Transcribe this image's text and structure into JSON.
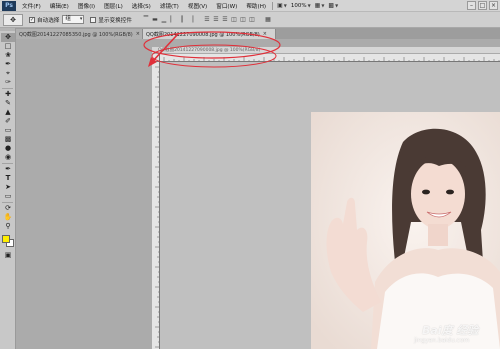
{
  "app": {
    "logo": "Ps"
  },
  "menubar": {
    "items": [
      "文件(F)",
      "编辑(E)",
      "图像(I)",
      "图层(L)",
      "选择(S)",
      "滤镜(T)",
      "视图(V)",
      "窗口(W)",
      "帮助(H)"
    ],
    "zoom": "100%"
  },
  "optbar": {
    "auto_select_label": "自动选择",
    "auto_select_target": "组",
    "show_transform_label": "显示变换控件"
  },
  "tabs": [
    {
      "label": "QQ截图20141227085350.jpg @ 100%(RGB/8)",
      "close": "×",
      "active": false
    },
    {
      "label": "QQ截图20141227090008.jpg @ 100%(RGB/8)",
      "close": "×",
      "active": true
    }
  ],
  "document": {
    "floating_title": "QQ截图20141227090008.jpg @ 100%(RGB/8)"
  },
  "colors": {
    "foreground": "#ffee00",
    "background": "#ffffff",
    "annotation": "#e0303a"
  },
  "watermark": {
    "brand": "Bai度 经验",
    "url": "jingyan.baidu.com"
  }
}
